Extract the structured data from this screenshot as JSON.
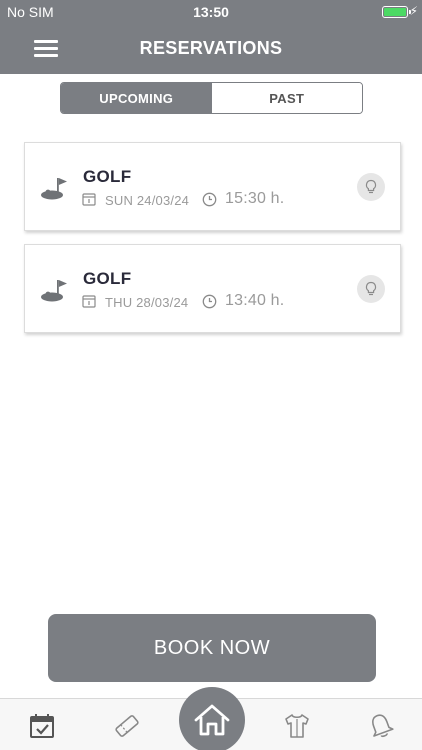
{
  "status_bar": {
    "carrier": "No SIM",
    "time": "13:50",
    "battery_level": 1.0,
    "battery_color": "#4cd964"
  },
  "header": {
    "title": "RESERVATIONS",
    "menu_icon": "hamburger-menu-icon",
    "background": "#7b7e83"
  },
  "tabs": {
    "upcoming_label": "UPCOMING",
    "past_label": "PAST",
    "selected": "upcoming"
  },
  "reservations": [
    {
      "activity": "GOLF",
      "date": "SUN 24/03/24",
      "time": "15:30 h.",
      "activity_icon": "golf-icon",
      "action_icon": "lightbulb-icon"
    },
    {
      "activity": "GOLF",
      "date": "THU 28/03/24",
      "time": "13:40 h.",
      "activity_icon": "golf-icon",
      "action_icon": "lightbulb-icon"
    }
  ],
  "book_button": {
    "label": "BOOK NOW"
  },
  "tab_bar": {
    "items": [
      {
        "icon": "calendar-check-icon",
        "active": true
      },
      {
        "icon": "ticket-icon",
        "active": false
      },
      {
        "icon": "home-icon",
        "active": false
      },
      {
        "icon": "shirt-icon",
        "active": false
      },
      {
        "icon": "bell-icon",
        "active": false
      }
    ]
  },
  "colors": {
    "primary_gray": "#7b7e83",
    "text_dark": "#2a2a3a",
    "text_muted": "#9a9a9a"
  }
}
